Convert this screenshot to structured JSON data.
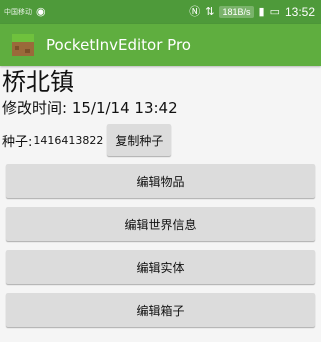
{
  "status_bar": {
    "carrier": "中国移动",
    "right_icons": [
      "nfc-icon",
      "data-arrows-icon",
      "signal-icon",
      "battery-icon"
    ],
    "net_speed": "181B/s",
    "time": "13:52"
  },
  "app_bar": {
    "title": "PocketInvEditor Pro",
    "logo": "grass-block-icon",
    "color": "#5fae3f"
  },
  "world": {
    "name": "桥北镇",
    "modified": "修改时间: 15/1/14 13:42",
    "seed_label": "种子:",
    "seed_value": "1416413822",
    "copy_seed_label": "复制种子"
  },
  "menu": {
    "edit_items": "编辑物品",
    "edit_world_info": "编辑世界信息",
    "edit_entities": "编辑实体",
    "edit_chests": "编辑箱子"
  }
}
